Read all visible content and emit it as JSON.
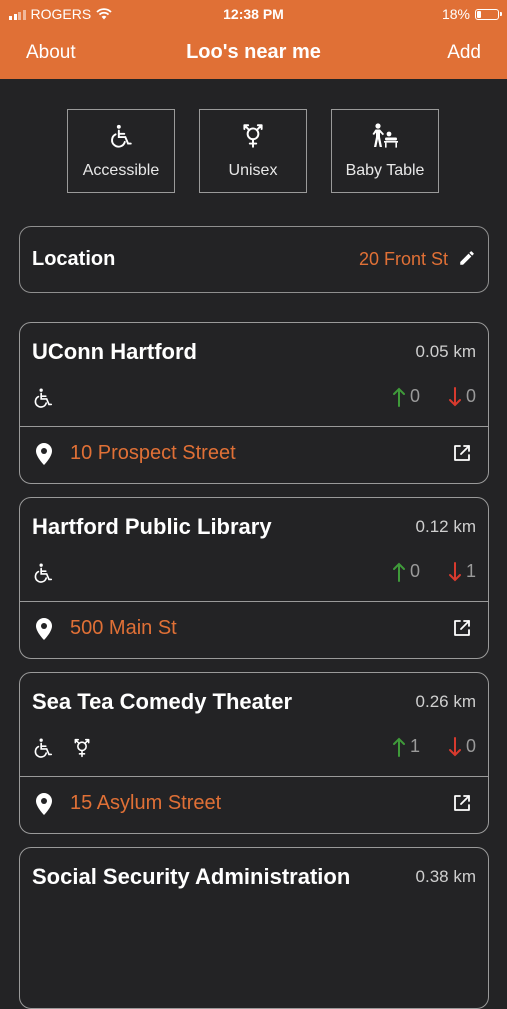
{
  "status": {
    "carrier": "ROGERS",
    "time": "12:38 PM",
    "battery": "18%"
  },
  "nav": {
    "left": "About",
    "title": "Loo's near me",
    "right": "Add"
  },
  "filters": [
    {
      "label": "Accessible",
      "icon": "wheelchair-icon"
    },
    {
      "label": "Unisex",
      "icon": "unisex-icon"
    },
    {
      "label": "Baby Table",
      "icon": "baby-changing-icon"
    }
  ],
  "location": {
    "label": "Location",
    "value": "20 Front St",
    "icon": "pencil-icon"
  },
  "colors": {
    "accent": "#e07036",
    "background": "#232325",
    "upvote": "#3f9a3a",
    "downvote": "#d83a2e"
  },
  "loos": [
    {
      "name": "UConn Hartford",
      "distance": "0.05 km",
      "up": "0",
      "down": "0",
      "address": "10 Prospect Street",
      "features": [
        "wheelchair-icon"
      ]
    },
    {
      "name": "Hartford Public Library",
      "distance": "0.12 km",
      "up": "0",
      "down": "1",
      "address": "500 Main St",
      "features": [
        "wheelchair-icon"
      ]
    },
    {
      "name": "Sea Tea Comedy Theater",
      "distance": "0.26 km",
      "up": "1",
      "down": "0",
      "address": "15 Asylum Street",
      "features": [
        "wheelchair-icon",
        "unisex-icon"
      ]
    },
    {
      "name": "Social Security Administration",
      "distance": "0.38 km"
    }
  ]
}
